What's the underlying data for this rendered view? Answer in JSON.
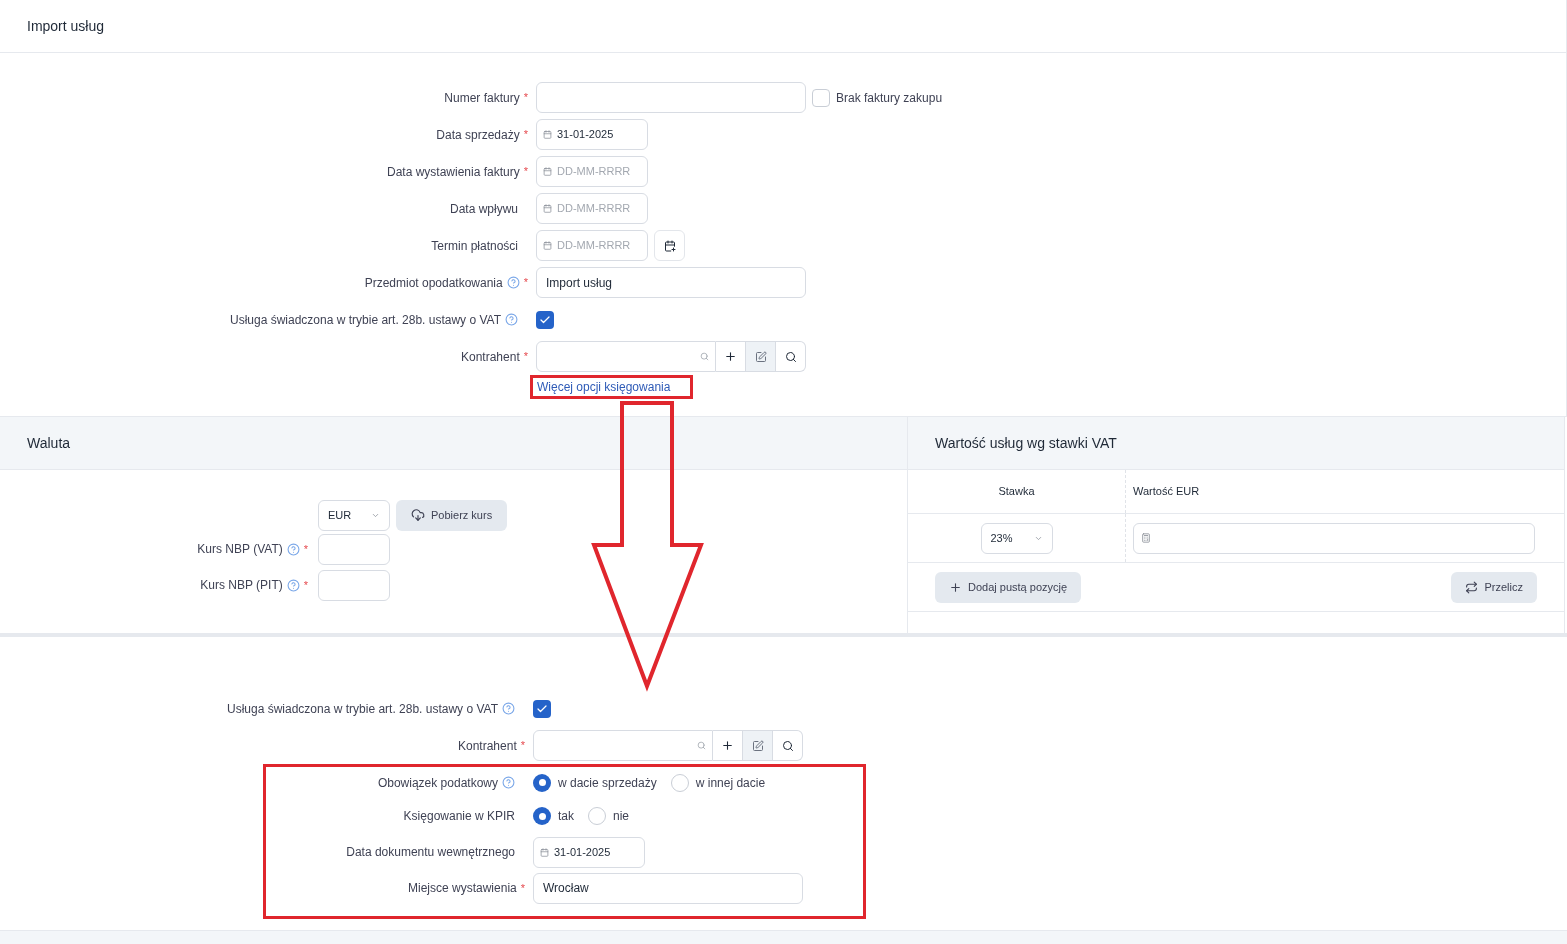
{
  "page_title": "Import usług",
  "form": {
    "fields": [
      {
        "kind": "text",
        "label": "Numer faktury",
        "required_mark": "*",
        "help": false,
        "side_checkbox": {
          "label": "Brak faktury zakupu",
          "checked": false
        }
      },
      {
        "kind": "date",
        "label": "Data sprzedaży",
        "required_mark": "*",
        "help": false,
        "value": "31-01-2025"
      },
      {
        "kind": "date",
        "label": "Data wystawienia faktury",
        "required_mark": "*",
        "help": false,
        "placeholder": "DD-MM-RRRR"
      },
      {
        "kind": "date",
        "label": "Data wpływu",
        "help": false,
        "placeholder": "DD-MM-RRRR"
      },
      {
        "kind": "date",
        "label": "Termin płatności",
        "help": false,
        "placeholder": "DD-MM-RRRR",
        "calendar_button": true
      },
      {
        "kind": "text",
        "label": "Przedmiot opodatkowania",
        "required_mark": "*",
        "help": true,
        "value": "Import usług"
      },
      {
        "kind": "checkbox",
        "label": "Usługa świadczona w trybie art. 28b. ustawy o VAT",
        "help": true,
        "checked": true
      },
      {
        "kind": "search",
        "label": "Kontrahent",
        "required_mark": "*",
        "help": false
      }
    ],
    "link": "Więcej opcji księgowania"
  },
  "currency_panel": {
    "title": "Waluta",
    "currency": "EUR",
    "fetch_button": "Pobierz kurs",
    "rates": [
      {
        "label": "Kurs NBP (VAT)",
        "required_mark": "*",
        "help": true
      },
      {
        "label": "Kurs NBP (PIT)",
        "required_mark": "*",
        "help": true
      }
    ]
  },
  "vat_panel": {
    "title": "Wartość usług wg stawki VAT",
    "columns": [
      "Stawka",
      "Wartość EUR"
    ],
    "rows": [
      {
        "rate": "23%"
      }
    ],
    "add_button": "Dodaj pustą pozycję",
    "recalc_button": "Przelicz"
  },
  "details": {
    "fields": [
      {
        "kind": "checkbox",
        "label": "Usługa świadczona w trybie art. 28b. ustawy o VAT",
        "help": true,
        "checked": true
      },
      {
        "kind": "search",
        "label": "Kontrahent",
        "required_mark": "*",
        "help": false
      }
    ],
    "highlighted_fields": [
      {
        "kind": "radio",
        "label": "Obowiązek podatkowy",
        "help": true,
        "options": [
          {
            "label": "w dacie sprzedaży",
            "selected": true
          },
          {
            "label": "w innej dacie",
            "selected": false
          }
        ]
      },
      {
        "kind": "radio",
        "label": "Księgowanie w KPIR",
        "help": false,
        "options": [
          {
            "label": "tak",
            "selected": true
          },
          {
            "label": "nie",
            "selected": false
          }
        ]
      },
      {
        "kind": "date",
        "label": "Data dokumentu wewnętrznego",
        "help": false,
        "value": "31-01-2025"
      },
      {
        "kind": "text",
        "label": "Miejsce wystawienia",
        "required_mark": "*",
        "help": false,
        "value": "Wrocław"
      }
    ]
  }
}
